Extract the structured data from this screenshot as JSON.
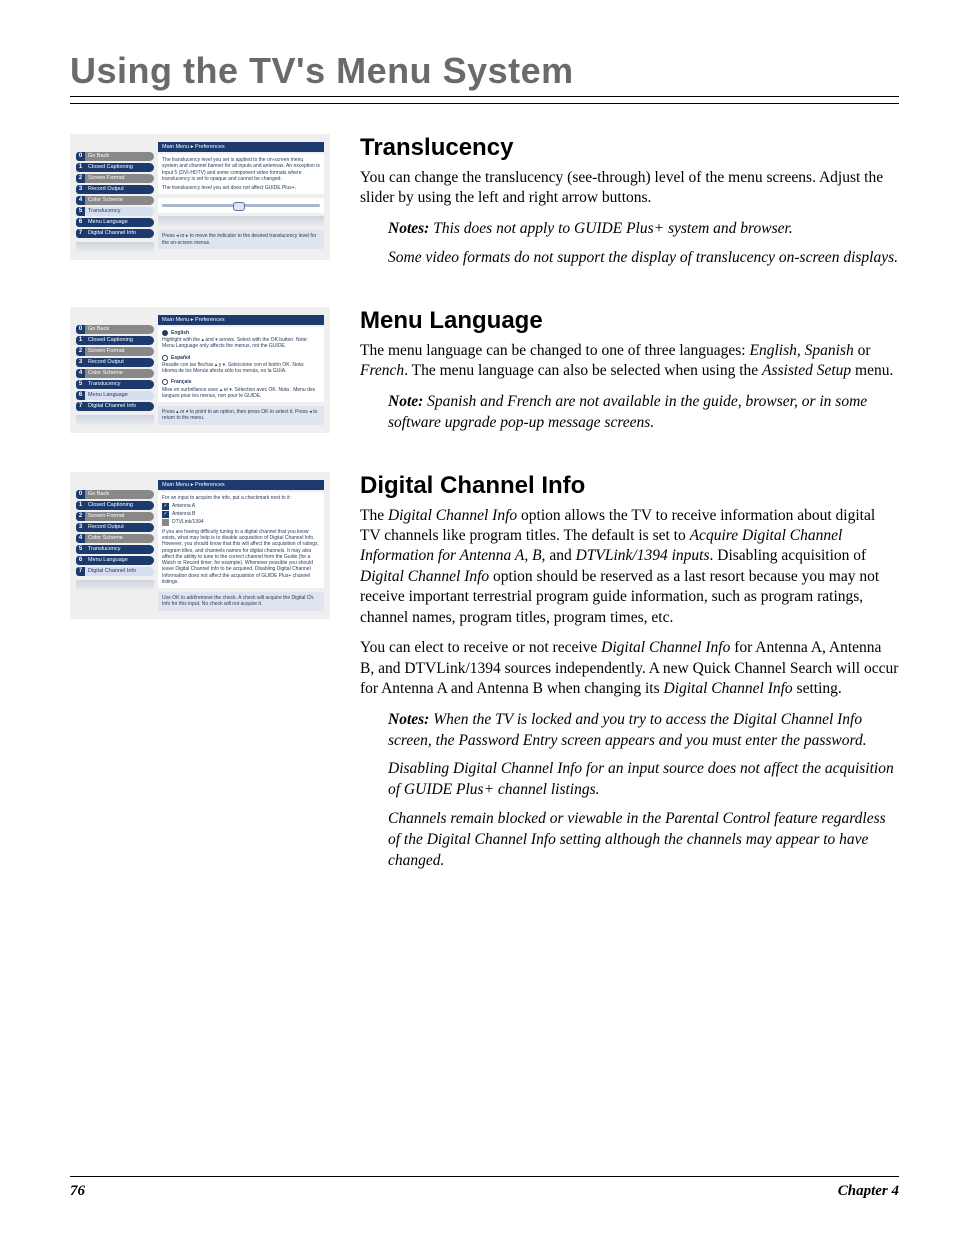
{
  "chapter_title": "Using the TV's Menu System",
  "sections": {
    "translucency": {
      "heading": "Translucency",
      "para": "You can change the translucency (see-through) level of the menu screens. Adjust the slider by using the left and right arrow buttons.",
      "notes": [
        "This does not apply to GUIDE Plus+ system and browser.",
        "Some video formats do not support the display of translucency on-screen displays."
      ]
    },
    "menu_language": {
      "heading": "Menu Language",
      "para_html": "The menu language can be changed to one of three languages: <span class=\"em\">English, Spanish</span> or <span class=\"em\">French</span>. The menu language can also be selected when using the <span class=\"em\">Assisted Setup</span> menu.",
      "notes": [
        "Spanish and French are not available in the guide, browser, or in some software upgrade pop-up message screens."
      ]
    },
    "digital_channel_info": {
      "heading": "Digital Channel Info",
      "para1_html": "The <span class=\"em\">Digital Channel Info</span> option allows the TV to receive information about digital TV channels like program titles. The default is set to <span class=\"em\">Acquire Digital Channel Information for Antenna A, B,</span> and <span class=\"em\">DTVLink/1394 inputs</span>. Disabling acquisition of <span class=\"em\">Digital Channel Info</span> option should be reserved as a last resort because you may not receive important terrestrial program guide information, such as program ratings, channel names, program titles, program times, etc.",
      "para2_html": "You can elect to receive or not receive <span class=\"em\">Digital Channel Info</span> for Antenna A, Antenna B, and DTVLink/1394 sources independently. A new Quick Channel Search will occur for Antenna A and Antenna B when changing its <span class=\"em\">Digital Channel Info</span> setting.",
      "notes": [
        "When the TV is locked and you try to access the Digital Channel Info screen, the Password Entry screen appears and you must enter the password.",
        "Disabling Digital Channel Info for an input source does not affect the acquisition of GUIDE Plus+ channel listings.",
        "Channels remain blocked or viewable in the Parental Control feature regardless of the Digital Channel Info setting although the channels may appear to have changed."
      ]
    }
  },
  "labels": {
    "notes_prefix": "Notes:",
    "note_prefix": "Note:"
  },
  "sidebar_items": [
    {
      "num": "0",
      "label": "Go Back",
      "grey": true
    },
    {
      "num": "1",
      "label": "Closed Captioning",
      "grey": false
    },
    {
      "num": "2",
      "label": "Screen Format",
      "grey": true
    },
    {
      "num": "3",
      "label": "Record Output",
      "grey": false
    },
    {
      "num": "4",
      "label": "Color Scheme",
      "grey": true
    },
    {
      "num": "5",
      "label": "Translucency",
      "grey": false
    },
    {
      "num": "6",
      "label": "Menu Language",
      "grey": false
    },
    {
      "num": "7",
      "label": "Digital Channel Info",
      "grey": false
    }
  ],
  "figures": {
    "translucency": {
      "breadcrumb": "Main Menu ▸ Preferences",
      "panel_text": "The translucency level you set is applied to the on-screen menu system and channel banner for all inputs and antennas. An exception is Input 5 (DVI-HDTV) and some component video formats where translucency is set to opaque and cannot be changed.",
      "panel_text2": "The translucency level you set does not affect GUIDE Plus+.",
      "hint": "Press ◂ or ▸ to move the indicator to the desired translucency level for the on-screen menus.",
      "highlight_index": 5
    },
    "menu_language": {
      "breadcrumb": "Main Menu ▸ Preferences",
      "languages": [
        {
          "name": "English",
          "desc": "Highlight with the ▴ and ▾ arrows. Select with the OK button. Note: Menu Language only affects the menus, not the GUIDE.",
          "on": true
        },
        {
          "name": "Español",
          "desc": "Resalte con las flechas ▴ y ▾. Seleccione con el botón OK. Nota: Idioma de los Menús afecta sólo los menús, no la GUÍA.",
          "on": false
        },
        {
          "name": "Français",
          "desc": "Mise en surbrillance avec ▴ et ▾. Sélection avec OK. Nota : Menu des langues pour les menus, non pour le GUIDE.",
          "on": false
        }
      ],
      "hint": "Press ▴ or ▾ to point to an option, then press OK to select it. Press ◂ to return to the menu.",
      "highlight_index": 6
    },
    "digital_channel_info": {
      "breadcrumb": "Main Menu ▸ Preferences",
      "lead": "For an input to acquire the info, put a checkmark next to it:",
      "options": [
        {
          "label": "Antenna A",
          "checked": true
        },
        {
          "label": "Antenna B",
          "checked": true
        },
        {
          "label": "DTVLink/1394",
          "checked": false
        }
      ],
      "body": "If you are having difficulty tuning to a digital channel that you know exists, what may help is to disable acquisition of Digital Channel Info. However, you should know that this will affect the acquisition of ratings, program titles, and channels names for digital channels. It may also affect the ability to tune to the correct channel from the Guide (for a Watch or Record timer, for example). Whenever possible you should leave Digital Channel Info to be acquired. Disabling Digital Channel Information does not affect the acquisition of GUIDE Plus+ channel listings.",
      "hint": "Use OK to add/remove the check. A check will acquire the Digital Ch. Info for this input. No check will not acquire it.",
      "highlight_index": 7
    }
  },
  "footer": {
    "page": "76",
    "chapter": "Chapter 4"
  }
}
